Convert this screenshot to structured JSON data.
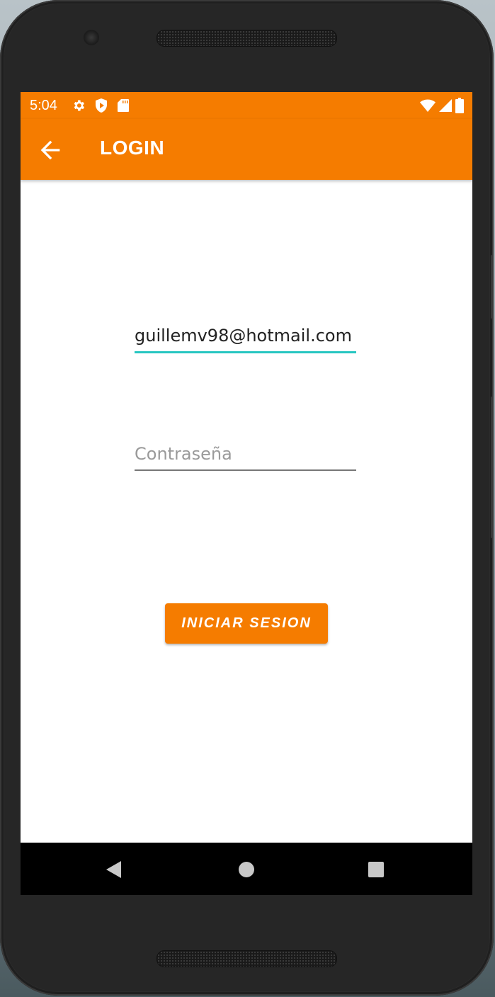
{
  "status_bar": {
    "time": "5:04",
    "left_icons": [
      "gear-icon",
      "shield-play-icon",
      "sd-card-icon"
    ],
    "right_icons": [
      "wifi-icon",
      "cell-signal-icon",
      "battery-icon"
    ]
  },
  "app_bar": {
    "title": "LOGIN",
    "back_icon": "arrow-back-icon",
    "color": "#f57c00"
  },
  "form": {
    "email_value": "guillemv98@hotmail.com",
    "password_placeholder": "Contraseña",
    "password_value": "",
    "submit_label": "INICIAR SESION",
    "focus_underline_color": "#26c6c1"
  },
  "nav_bar": {
    "buttons": [
      "back-triangle-icon",
      "home-circle-icon",
      "recents-square-icon"
    ]
  }
}
